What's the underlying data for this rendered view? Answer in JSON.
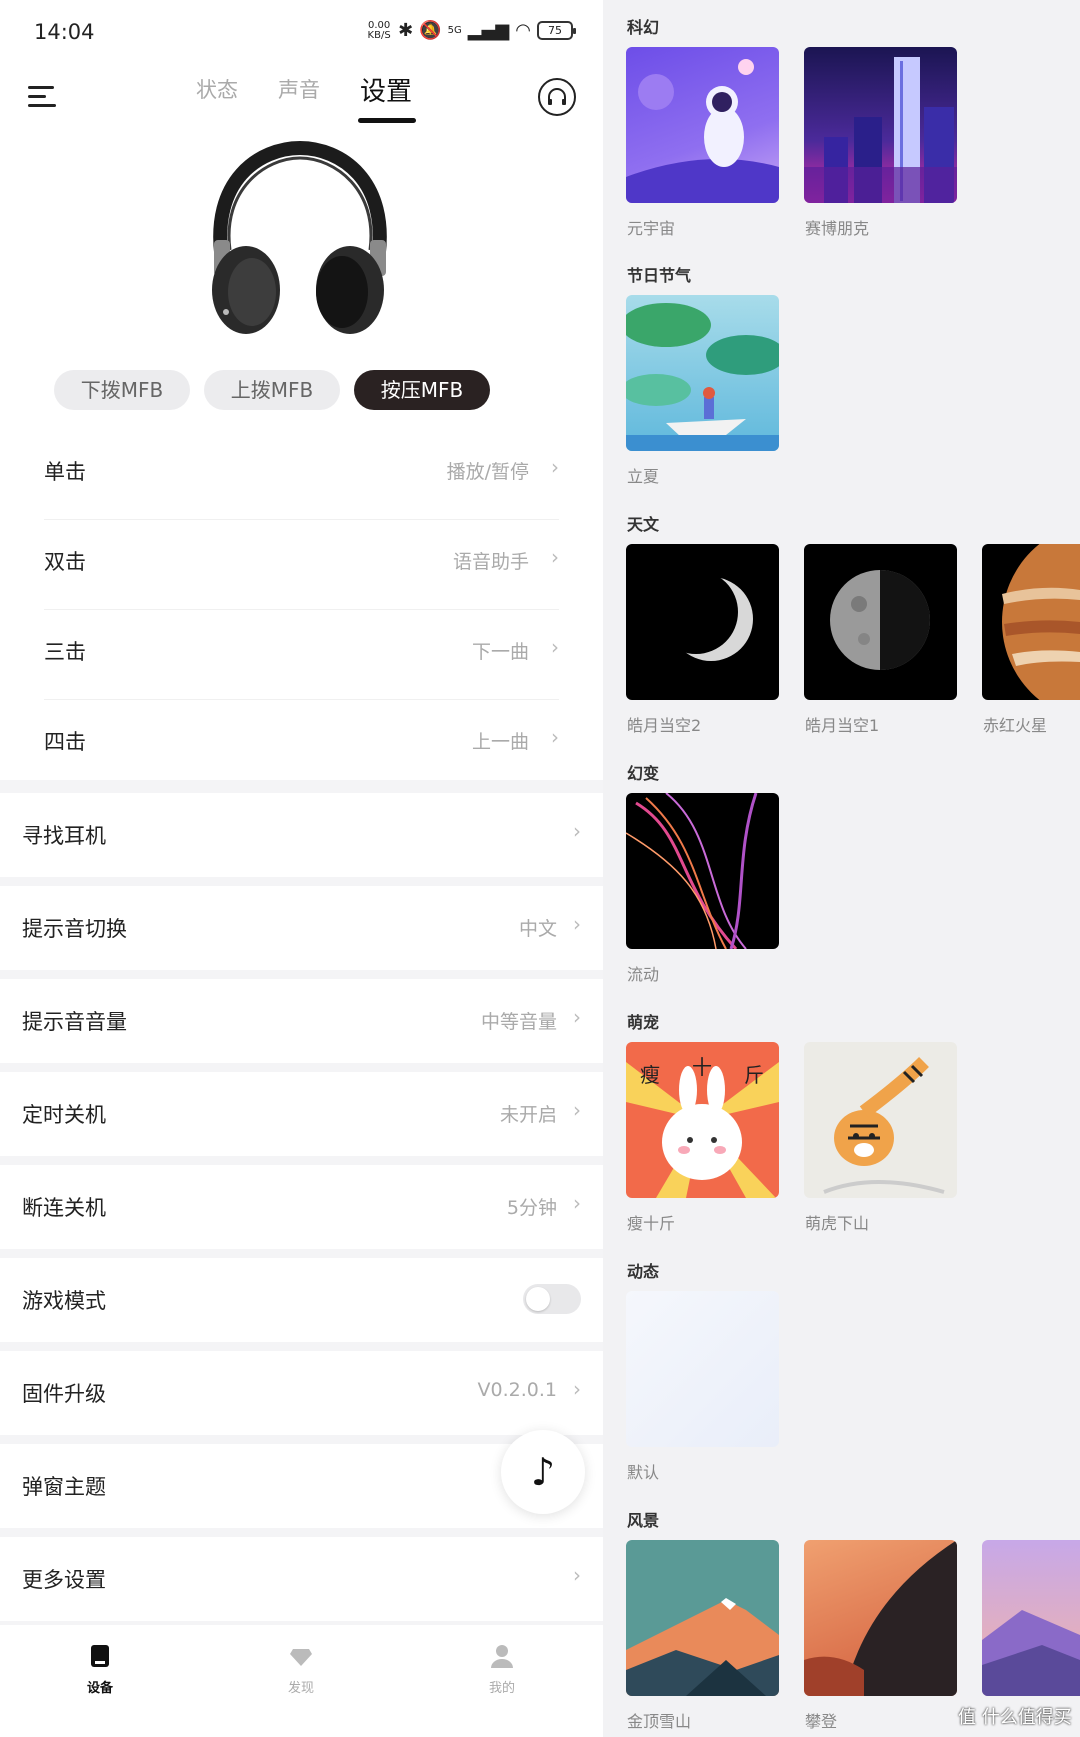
{
  "status_bar": {
    "time": "14:04",
    "net_speed": "0.00 KB/S",
    "network": "5G",
    "battery": "75",
    "icons": [
      "bluetooth-icon",
      "mute-icon",
      "signal-icon",
      "wifi-icon",
      "battery-icon"
    ]
  },
  "header": {
    "tabs": [
      {
        "label": "状态",
        "active": false
      },
      {
        "label": "声音",
        "active": false
      },
      {
        "label": "设置",
        "active": true
      }
    ]
  },
  "mfb_chips": [
    {
      "label": "下拨MFB",
      "active": false
    },
    {
      "label": "上拨MFB",
      "active": false
    },
    {
      "label": "按压MFB",
      "active": true
    }
  ],
  "click_actions": [
    {
      "label": "单击",
      "value": "播放/暂停"
    },
    {
      "label": "双击",
      "value": "语音助手"
    },
    {
      "label": "三击",
      "value": "下一曲"
    },
    {
      "label": "四击",
      "value": "上一曲"
    }
  ],
  "settings": [
    {
      "label": "寻找耳机",
      "value": "",
      "control": "chevron"
    },
    {
      "label": "提示音切换",
      "value": "中文",
      "control": "chevron"
    },
    {
      "label": "提示音音量",
      "value": "中等音量",
      "control": "chevron"
    },
    {
      "label": "定时关机",
      "value": "未开启",
      "control": "chevron"
    },
    {
      "label": "断连关机",
      "value": "5分钟",
      "control": "chevron"
    },
    {
      "label": "游戏模式",
      "value": "",
      "control": "toggle",
      "toggle_on": false
    },
    {
      "label": "固件升级",
      "value": "V0.2.0.1",
      "control": "chevron"
    },
    {
      "label": "弹窗主题",
      "value": "",
      "control": "none"
    },
    {
      "label": "更多设置",
      "value": "",
      "control": "chevron"
    }
  ],
  "bottom_nav": [
    {
      "label": "设备",
      "icon": "device-icon",
      "active": true
    },
    {
      "label": "发现",
      "icon": "discover-icon",
      "active": false
    },
    {
      "label": "我的",
      "icon": "profile-icon",
      "active": false
    }
  ],
  "themes": {
    "categories": [
      {
        "name": "科幻",
        "items": [
          "元宇宙",
          "赛博朋克"
        ]
      },
      {
        "name": "节日节气",
        "items": [
          "立夏"
        ]
      },
      {
        "name": "天文",
        "items": [
          "皓月当空2",
          "皓月当空1",
          "赤红火星"
        ]
      },
      {
        "name": "幻变",
        "items": [
          "流动"
        ]
      },
      {
        "name": "萌宠",
        "items": [
          "瘦十斤",
          "萌虎下山"
        ]
      },
      {
        "name": "动态",
        "items": [
          "默认"
        ]
      },
      {
        "name": "风景",
        "items": [
          "金顶雪山",
          "攀登",
          ""
        ]
      }
    ],
    "card_art_text": {
      "slim_ten": [
        "瘦",
        "十",
        "斤"
      ]
    }
  },
  "watermark": "值 什么值得买",
  "colors": {
    "accent_dark": "#2a2222",
    "text_primary": "#222222",
    "text_secondary": "#aaaaaa"
  }
}
